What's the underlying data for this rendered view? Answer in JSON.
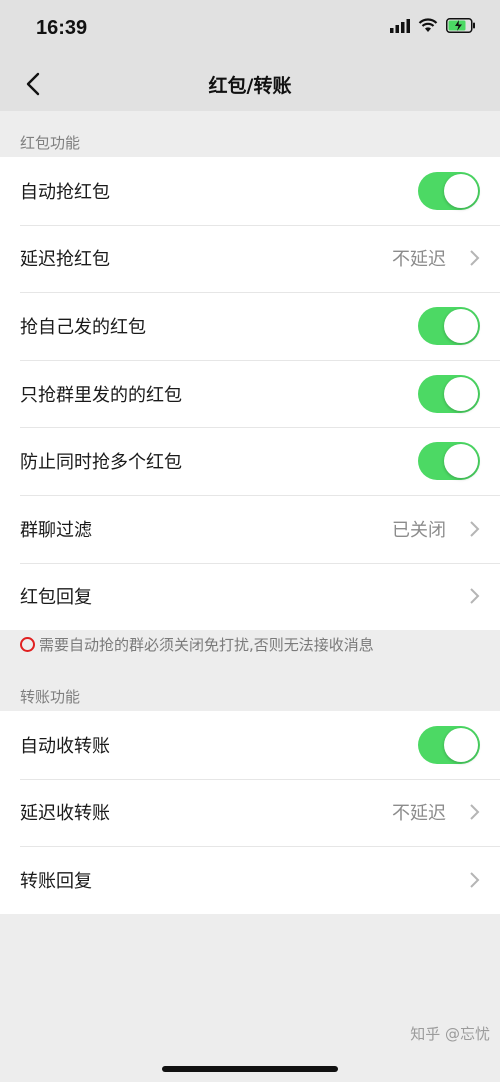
{
  "status_bar": {
    "time": "16:39"
  },
  "nav": {
    "title": "红包/转账"
  },
  "red_packet_section": {
    "header": "红包功能",
    "rows": [
      {
        "label": "自动抢红包",
        "type": "toggle",
        "on": true
      },
      {
        "label": "延迟抢红包",
        "type": "link",
        "value": "不延迟"
      },
      {
        "label": "抢自己发的红包",
        "type": "toggle",
        "on": true
      },
      {
        "label": "只抢群里发的的红包",
        "type": "toggle",
        "on": true
      },
      {
        "label": "防止同时抢多个红包",
        "type": "toggle",
        "on": true
      },
      {
        "label": "群聊过滤",
        "type": "link",
        "value": "已关闭"
      },
      {
        "label": "红包回复",
        "type": "link",
        "value": ""
      }
    ]
  },
  "notice": "需要自动抢的群必须关闭免打扰,否则无法接收消息",
  "transfer_section": {
    "header": "转账功能",
    "rows": [
      {
        "label": "自动收转账",
        "type": "toggle",
        "on": true
      },
      {
        "label": "延迟收转账",
        "type": "link",
        "value": "不延迟"
      },
      {
        "label": "转账回复",
        "type": "link",
        "value": ""
      }
    ]
  },
  "watermark": "知乎 @忘忧",
  "colors": {
    "toggle_on": "#4cd964",
    "notice_icon": "#e02020",
    "header_bg": "#e1e1e1",
    "page_bg": "#ededed"
  }
}
